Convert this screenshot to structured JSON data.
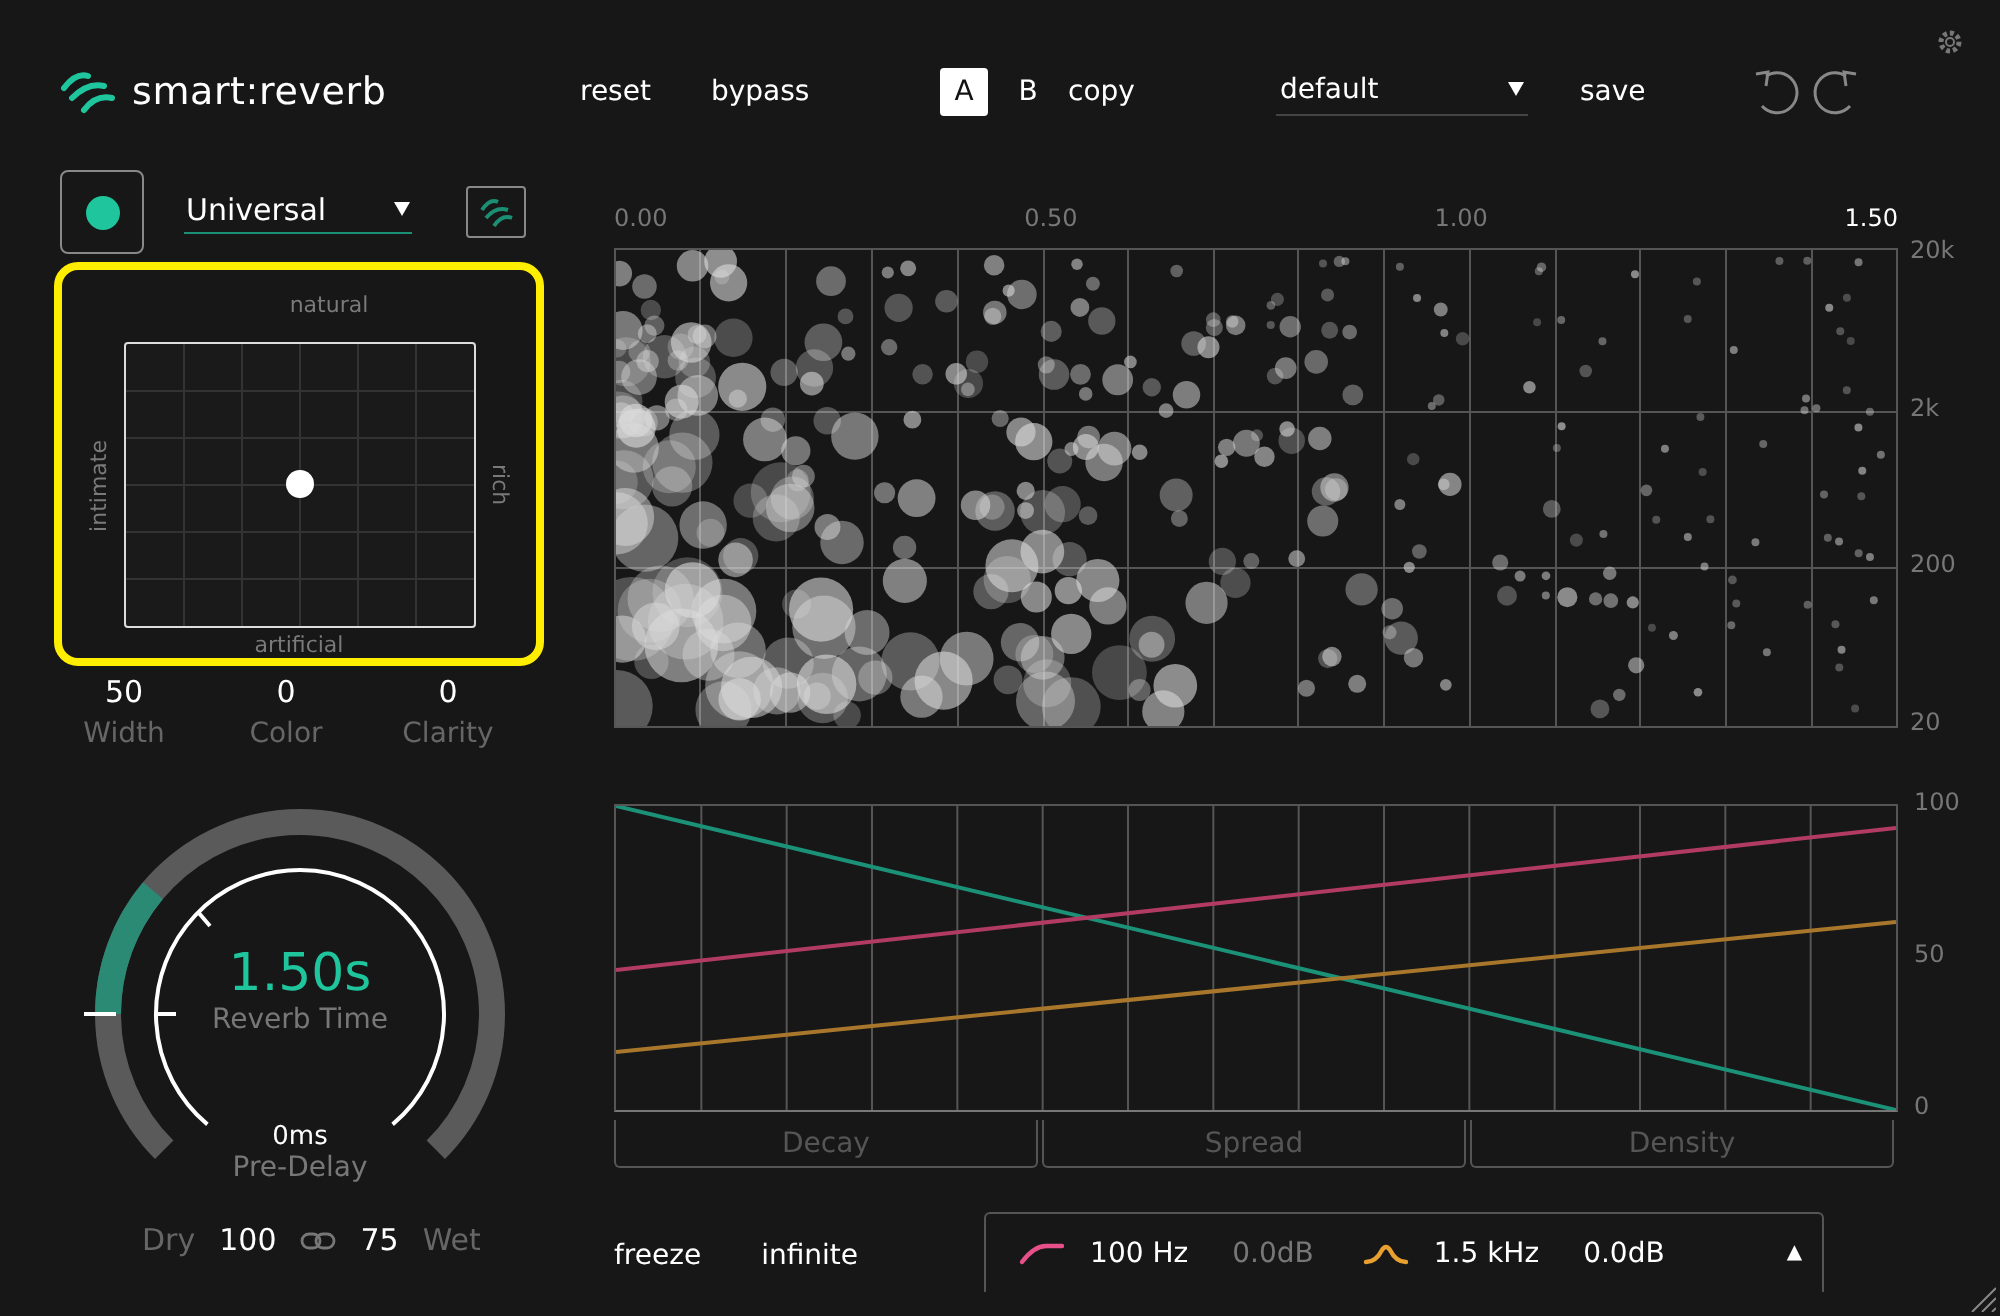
{
  "header": {
    "logo": "smart:reverb",
    "actions": [
      "reset",
      "bypass"
    ],
    "ab": [
      {
        "label": "A",
        "selected": true
      },
      {
        "label": "B",
        "selected": false
      }
    ],
    "copy": "copy",
    "preset": "default",
    "save": "save"
  },
  "profile": {
    "value": "Universal"
  },
  "xy_pad": {
    "top": "natural",
    "bottom": "artificial",
    "left": "intimate",
    "right": "rich"
  },
  "params": [
    {
      "value": "50",
      "label": "Width"
    },
    {
      "value": "0",
      "label": "Color"
    },
    {
      "value": "0",
      "label": "Clarity"
    }
  ],
  "knob": {
    "value": "1.50s",
    "label": "Reverb Time",
    "pre_value": "0ms",
    "pre_label": "Pre-Delay"
  },
  "mix": {
    "dry_label": "Dry",
    "dry": "100",
    "wet": "75",
    "wet_label": "Wet"
  },
  "spectrum": {
    "x_labels": [
      {
        "text": "0.00",
        "current": false
      },
      {
        "text": "0.50",
        "current": false
      },
      {
        "text": "1.00",
        "current": false
      },
      {
        "text": "1.50",
        "current": true
      }
    ],
    "y_labels": [
      "20k",
      "2k",
      "200",
      "20"
    ]
  },
  "envelope": {
    "y_labels": [
      "100",
      "50",
      "0"
    ],
    "sections": [
      "Decay",
      "Spread",
      "Density"
    ]
  },
  "footer": {
    "toggles": [
      "freeze",
      "infinite"
    ],
    "filters": [
      {
        "kind": "shelf",
        "freq": "100 Hz",
        "gain": "0.0dB",
        "color": "#e8508a",
        "active": false
      },
      {
        "kind": "bell",
        "freq": "1.5 kHz",
        "gain": "0.0dB",
        "color": "#e8a030",
        "active": true
      }
    ],
    "expand": "▲"
  }
}
